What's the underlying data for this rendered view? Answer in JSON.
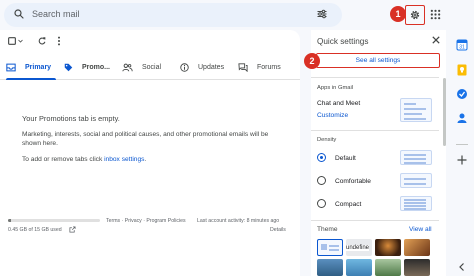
{
  "search": {
    "placeholder": "Search mail"
  },
  "callouts": {
    "one": "1",
    "two": "2"
  },
  "tabs": [
    {
      "label": "Primary"
    },
    {
      "label": "Promo..."
    },
    {
      "label": "Social"
    },
    {
      "label": "Updates"
    },
    {
      "label": "Forums"
    }
  ],
  "empty_state": {
    "title": "Your Promotions tab is empty.",
    "line1": "Marketing, interests, social and political causes, and other promotional emails will be",
    "line2": "shown here.",
    "settings_prefix": "To add or remove tabs click ",
    "settings_link": "inbox settings",
    "settings_suffix": "."
  },
  "footer": {
    "storage_used_fraction": 0.03,
    "storage": "0.45 GB of 15 GB used",
    "terms": "Terms",
    "privacy": "Privacy",
    "policies": "Program Policies",
    "sep": "·",
    "activity": "Last account activity: 8 minutes ago",
    "details": "Details"
  },
  "quick_settings": {
    "title": "Quick settings",
    "see_all": "See all settings",
    "apps_header": "Apps in Gmail",
    "chat_meet": "Chat and Meet",
    "customize": "Customize",
    "density_header": "Density",
    "density_options": [
      {
        "label": "Default",
        "selected": true
      },
      {
        "label": "Comfortable",
        "selected": false
      },
      {
        "label": "Compact",
        "selected": false
      }
    ],
    "theme_header": "Theme",
    "view_all": "View all",
    "theme_caption": "undefine"
  },
  "colors": {
    "accent": "#0b57d0",
    "callout": "#d93025"
  }
}
